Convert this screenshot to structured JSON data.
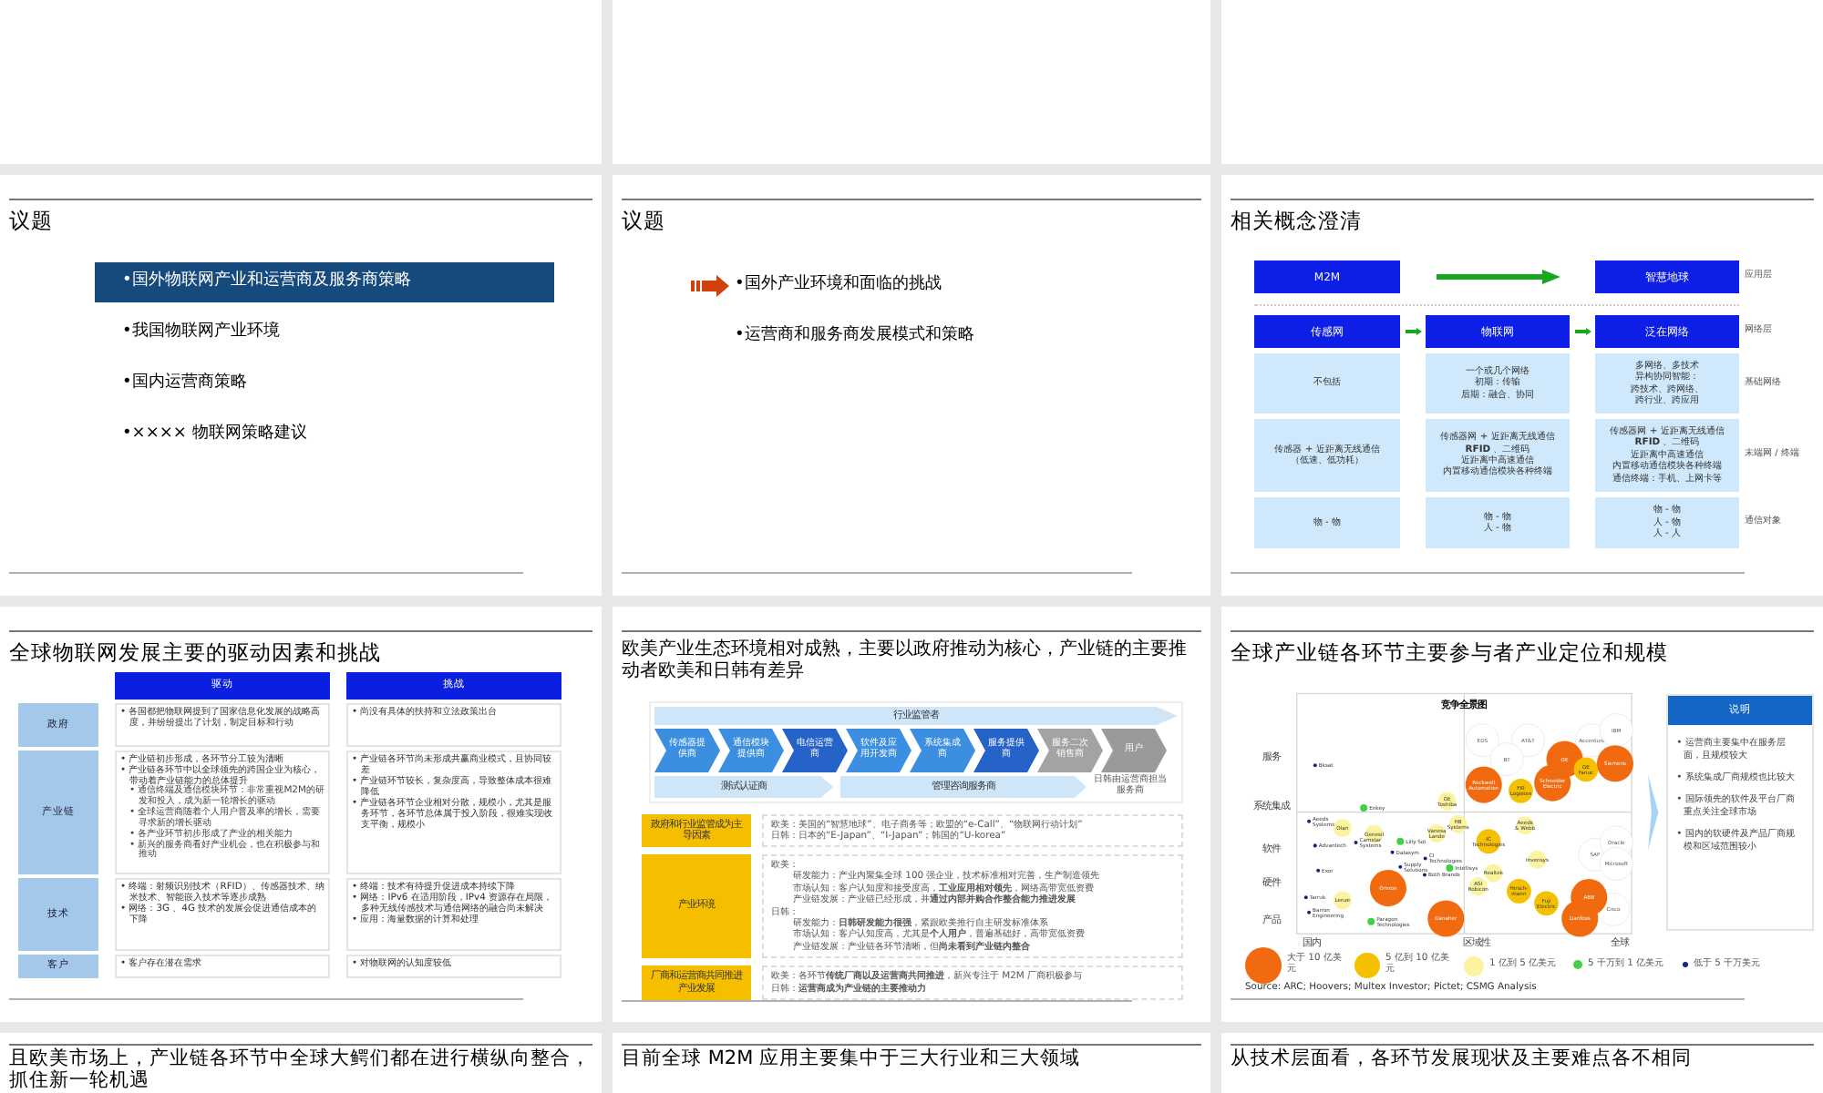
{
  "slides": [
    {
      "kind": "agenda",
      "title": "议题",
      "items": [
        {
          "text": "•国外物联网产业和运营商及服务商策略",
          "selected": true
        },
        {
          "text": "•我国物联网产业环境",
          "selected": false
        },
        {
          "text": "•国内运营商策略",
          "selected": false
        },
        {
          "text": "•×××× 物联网策略建议",
          "selected": false
        }
      ]
    },
    {
      "kind": "agenda-arrow",
      "title": "议题",
      "items": [
        {
          "text": "•国外产业环境和面临的挑战",
          "selected": true
        },
        {
          "text": "•运营商和服务商发展模式和策略",
          "selected": false
        }
      ]
    },
    {
      "kind": "concept",
      "title": "相关概念澄清",
      "top": [
        "M2M",
        "智慧地球"
      ],
      "headers": [
        "传感网",
        "物联网",
        "泛在网络"
      ],
      "layers": [
        "应用层",
        "网络层",
        "基础网络",
        "末端网 / 终端",
        "通信对象"
      ],
      "rows": [
        [
          [
            "不包括"
          ],
          [
            "一个或几个网络",
            "初期：传输",
            "后期：融合、协同"
          ],
          [
            "多网络、多技术",
            "异构协同智能：",
            "跨技术、跨网络、",
            "跨行业、跨应用"
          ]
        ],
        [
          [
            "传感器 + 近距离无线通信",
            "（低速、低功耗）"
          ],
          [
            "传感器网 + 近距离无线通信",
            "**RFID** 、二维码",
            "近距离中高速通信",
            "内置移动通信模块各种终端"
          ],
          [
            "传感器网 + 近距离无线通信",
            "**RFID** 、二维码",
            "近距离中高速通信",
            "内置移动通信模块各种终端",
            "通信终端：手机、上网卡等"
          ]
        ],
        [
          [
            "物 - 物"
          ],
          [
            "物 - 物",
            "人 - 物"
          ],
          [
            "物 - 物",
            "人 - 物",
            "人 - 人"
          ]
        ]
      ]
    },
    {
      "kind": "drivers",
      "title": "全球物联网发展主要的驱动因素和挑战",
      "headers": [
        "驱动",
        "挑战"
      ],
      "rows": [
        {
          "label": "政府",
          "drivers": [
            {
              "text": "• 各国都把物联网提到了国家信息化发展的战略高度，并纷纷提出了计划，制定目标和行动"
            }
          ],
          "challenges": [
            {
              "text": "• 尚没有具体的扶持和立法政策出台"
            }
          ]
        },
        {
          "label": "产业链",
          "drivers": [
            {
              "text": "• 产业链初步形成，各环节分工较为清晰"
            },
            {
              "text": "• 产业链各环节中以全球领先的跨国企业为核心，带动着产业链能力的总体提升",
              "children": [
                {
                  "text": "• 通信终端及通信模块环节：非常重视M2M的研发和投入，成为新一轮增长的驱动"
                },
                {
                  "text": "• 全球运营商随着个人用户普及率的增长，需要寻求新的增长驱动"
                },
                {
                  "text": "• 各产业环节初步形成了产业的相关能力"
                },
                {
                  "text": "• 新兴的服务商看好产业机会，也在积极参与和推动"
                }
              ]
            }
          ],
          "challenges": [
            {
              "text": "• 产业链各环节尚未形成共赢商业模式，且协同较差"
            },
            {
              "text": "• 产业链环节较长，复杂度高，导致整体成本很难降低"
            },
            {
              "text": "• 产业链各环节企业相对分散，规模小，尤其是服务环节，各环节总体属于投入阶段，很难实现收支平衡，规模小"
            }
          ]
        },
        {
          "label": "技术",
          "drivers": [
            {
              "text": "• 终端：射频识别技术（RFID）、传感器技术、纳米技术、智能嵌入技术等逐步成熟"
            },
            {
              "text": "• 网络：3G 、4G 技术的发展会促进通信成本的下降"
            }
          ],
          "challenges": [
            {
              "text": "• 终端：技术有待提升促进成本持续下降"
            },
            {
              "text": "• 网络：IPv6 在适用阶段，IPv4 资源存在局限，多种无线传感技术与通信网络的融合尚未解决"
            },
            {
              "text": "• 应用：海量数据的计算和处理"
            }
          ]
        },
        {
          "label": "客户",
          "drivers": [
            {
              "text": "• 客户存在潜在需求"
            }
          ],
          "challenges": [
            {
              "text": "• 对物联网的认知度较低"
            }
          ]
        }
      ]
    },
    {
      "kind": "ecosystem",
      "title": "欧美产业生态环境相对成熟，主要以政府推动为核心，产业链的主要推动者欧美和日韩有差异",
      "regulator": "行业监管者",
      "chain": [
        {
          "text": "传感器提供商",
          "color": "#3b8ee0"
        },
        {
          "text": "通信模块提供商",
          "color": "#3b8ee0"
        },
        {
          "text": "电信运营商",
          "color": "#2563c8"
        },
        {
          "text": "软件及应用开发商",
          "color": "#3b8ee0"
        },
        {
          "text": "系统集成商",
          "color": "#3b8ee0"
        },
        {
          "text": "服务提供商",
          "color": "#2563c8"
        },
        {
          "text": "服务二次销售商",
          "color": "#a3a3a3"
        },
        {
          "text": "用户",
          "color": "#9a9a9a"
        }
      ],
      "support": [
        "测试认证商",
        "管理咨询服务商"
      ],
      "note": "日韩由运营商担当服务商",
      "rows": [
        {
          "label": "政府和行业监管成为主导因素",
          "lines": [
            {
              "kind": "line",
              "text": "欧美：美国的“智慧地球”、电子商务等；欧盟的“e-Call”、“物联网行动计划”"
            },
            {
              "kind": "line",
              "text": "日韩：日本的“E-Japan”、“I-Japan”；韩国的“U-korea”"
            }
          ]
        },
        {
          "label": "产业环境",
          "lines": [
            {
              "kind": "line",
              "text": "欧美："
            },
            {
              "kind": "sub",
              "text": "研发能力：产业内聚集全球 100 强企业，技术标准相对完善，生产制造领先"
            },
            {
              "kind": "sub",
              "text": "市场认知：客户认知度和接受度高，**工业应用相对领先**，网络高带宽低资费"
            },
            {
              "kind": "sub",
              "text": "产业链发展：产业链已经形成，并**通过内部并购合作整合能力推进发展**"
            },
            {
              "kind": "line",
              "text": "日韩："
            },
            {
              "kind": "sub",
              "text": "研发能力：**日韩研发能力很强**，紧跟欧美推行自主研发标准体系"
            },
            {
              "kind": "sub",
              "text": "市场认知：客户认知度高，尤其是**个人用户**，普遍基础好，高带宽低资费"
            },
            {
              "kind": "sub",
              "text": "产业链发展：产业链各环节清晰，但**尚未看到产业链内整合**"
            }
          ]
        },
        {
          "label": "厂商和运营商共同推进产业发展",
          "lines": [
            {
              "kind": "line",
              "text": "欧美：各环节**传统厂商以及运营商共同推进**，新兴专注于 M2M 厂商积极参与"
            },
            {
              "kind": "line",
              "text": "日韩：**运营商成为产业链的主要推动力**"
            }
          ]
        }
      ]
    },
    {
      "kind": "landscape",
      "title": "全球产业链各环节主要参与者产业定位和规模",
      "chart_title": "竞争全景图",
      "y_labels": [
        "服务",
        "系统集成",
        "软件",
        "硬件",
        "产品"
      ],
      "x_labels": [
        "国内",
        "区域性",
        "全球"
      ],
      "bubbles": [
        {
          "label": "EDS",
          "kind": "unrated"
        },
        {
          "label": "AT&T",
          "kind": "unrated"
        },
        {
          "label": "Accenture",
          "kind": "unrated"
        },
        {
          "label": "IBM",
          "kind": "unrated"
        },
        {
          "label": "Bksat",
          "kind": "tiny"
        },
        {
          "label": "BT",
          "kind": "unrated"
        },
        {
          "label": "GE",
          "kind": "giant"
        },
        {
          "label": "GE\nFanuc",
          "kind": "large"
        },
        {
          "label": "Siemens",
          "kind": "giant"
        },
        {
          "label": "Rockwell\nAutomation",
          "kind": "giant"
        },
        {
          "label": "FKI\nLogistex",
          "kind": "large"
        },
        {
          "label": "Schneider\nElectric",
          "kind": "giant"
        },
        {
          "label": "Enkey",
          "kind": "small"
        },
        {
          "label": "GE\nToshiba",
          "kind": "medium"
        },
        {
          "label": "Aeeds\nSystems",
          "kind": "tiny"
        },
        {
          "label": "Olan",
          "kind": "medium"
        },
        {
          "label": "Genesil",
          "kind": "medium"
        },
        {
          "label": "Vanesa\nLande",
          "kind": "medium"
        },
        {
          "label": "HB\nSystems",
          "kind": "medium"
        },
        {
          "label": "Aeeds\n& Webb",
          "kind": "medium"
        },
        {
          "label": "Advantech",
          "kind": "tiny"
        },
        {
          "label": "Camstar\nSystems",
          "kind": "tiny"
        },
        {
          "label": "Lilly Sot",
          "kind": "small"
        },
        {
          "label": "Datasym",
          "kind": "tiny"
        },
        {
          "label": "CI\nTechnologies",
          "kind": "tiny"
        },
        {
          "label": "IC\nTechnologies",
          "kind": "large"
        },
        {
          "label": "SAP",
          "kind": "unrated"
        },
        {
          "label": "Oracle",
          "kind": "unrated"
        },
        {
          "label": "Exor",
          "kind": "tiny"
        },
        {
          "label": "Supply\nSolutions",
          "kind": "tiny"
        },
        {
          "label": "Both Brands",
          "kind": "tiny"
        },
        {
          "label": "Intellisys",
          "kind": "small"
        },
        {
          "label": "Realtek",
          "kind": "medium"
        },
        {
          "label": "Invensys",
          "kind": "medium"
        },
        {
          "label": "Microsoft",
          "kind": "unrated"
        },
        {
          "label": "Tarruk",
          "kind": "tiny"
        },
        {
          "label": "Lenze",
          "kind": "medium"
        },
        {
          "label": "Omron",
          "kind": "giant"
        },
        {
          "label": "ASI\nRobicon",
          "kind": "medium"
        },
        {
          "label": "Hirsch-\nmann",
          "kind": "large"
        },
        {
          "label": "Fuji\nElectric",
          "kind": "large"
        },
        {
          "label": "ABB",
          "kind": "giant"
        },
        {
          "label": "Cisco",
          "kind": "unrated"
        },
        {
          "label": "Barron\nEngineering",
          "kind": "tiny"
        },
        {
          "label": "Paragon\nTechnologies",
          "kind": "small"
        },
        {
          "label": "Danaher",
          "kind": "giant"
        },
        {
          "label": "Danfoss",
          "kind": "giant"
        }
      ],
      "legend": [
        {
          "label": "大于 10 亿美元",
          "color": "#f26a10"
        },
        {
          "label": "5 亿到 10 亿美元",
          "color": "#f5c000"
        },
        {
          "label": "1 亿到 5 亿美元",
          "color": "#fbf3a0"
        },
        {
          "label": "5 千万到 1 亿美元",
          "color": "#44d044"
        },
        {
          "label": "低于 5 千万美元",
          "color": "#1a237e"
        }
      ],
      "source": "Source: ARC; Hoovers; Multex Investor; Pictet; CSMG Analysis",
      "note_title": "说明",
      "notes": [
        "• 运营商主要集中在服务层面，且规模较大",
        "• 系统集成厂商规模也比较大",
        "• 国际领先的软件及平台厂商重点关注全球市场",
        "• 国内的软硬件及产品厂商规模和区域范围较小"
      ]
    },
    {
      "kind": "title-only",
      "title": "且欧美市场上，产业链各环节中全球大鳄们都在进行横纵向整合，抓住新一轮机遇"
    },
    {
      "kind": "title-only",
      "title": "目前全球 M2M 应用主要集中于三大行业和三大领域"
    },
    {
      "kind": "title-only",
      "title": "从技术层面看，各环节发展现状及主要难点各不相同"
    }
  ]
}
